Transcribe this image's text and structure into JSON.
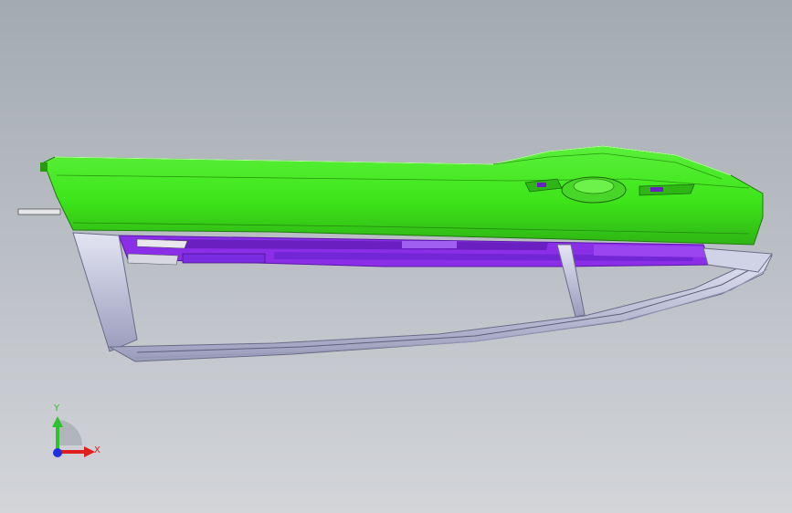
{
  "view": {
    "background_top": "#a3aab2",
    "background_bottom": "#d3d5d9"
  },
  "model": {
    "housing_color": "#3ee51a",
    "housing_dark": "#2fb514",
    "internals_color": "#8a2ee8",
    "internals_dark": "#5a18a8",
    "frame_color": "#c6c8e2",
    "frame_dark": "#7a7c99"
  },
  "triad": {
    "y_label": "Y",
    "x_label": "X",
    "y_color": "#2fc22f",
    "x_color": "#e02020",
    "z_color": "#2030e0"
  }
}
